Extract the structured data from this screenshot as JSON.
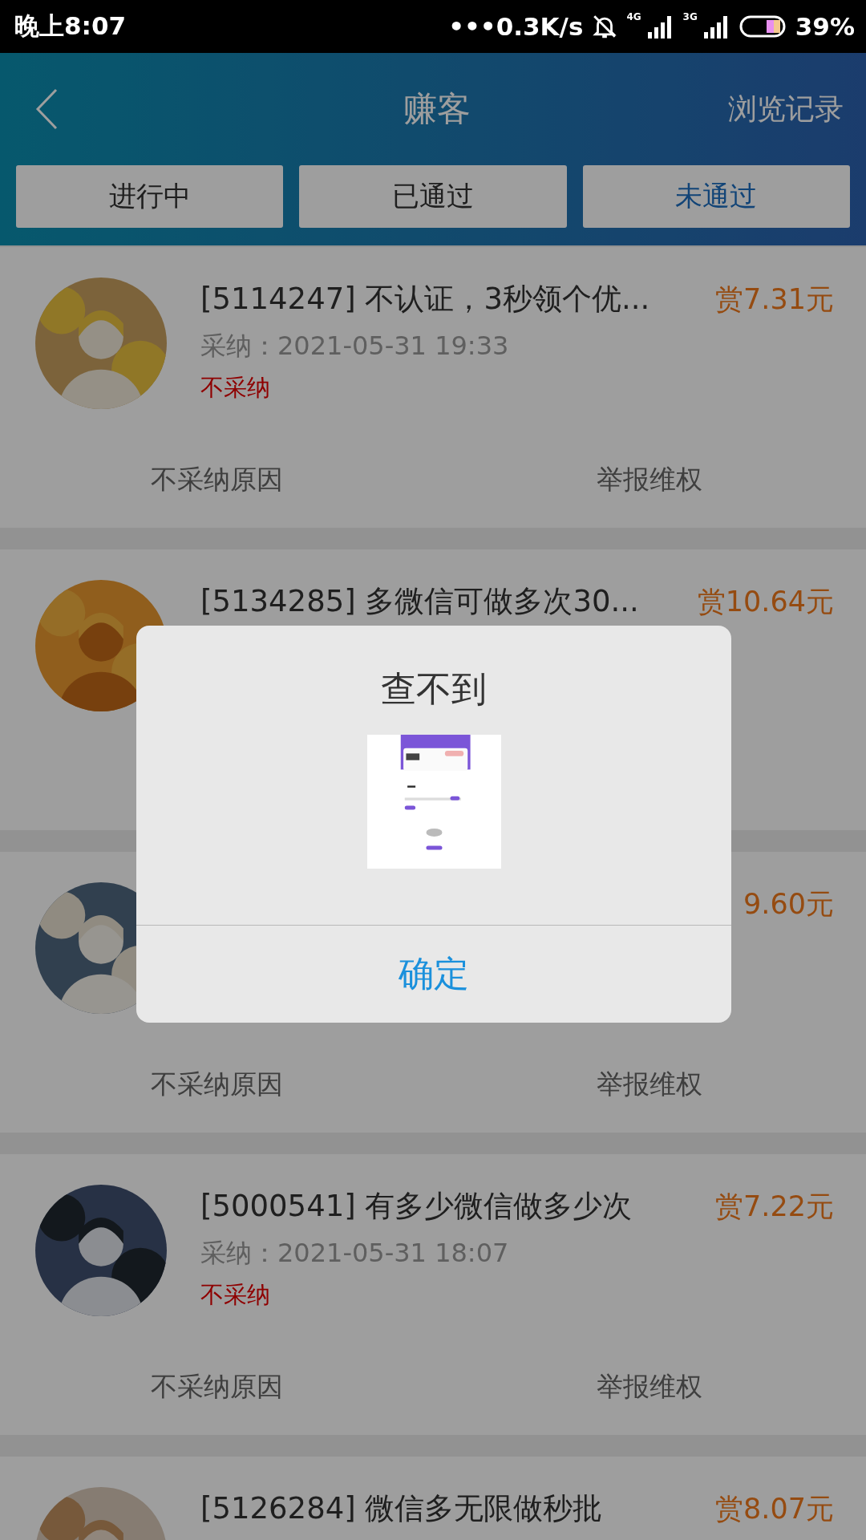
{
  "status_bar": {
    "time": "晚上8:07",
    "network_speed": "•••0.3K/s",
    "signal_1_label": "4G",
    "signal_2_label": "3G",
    "battery": "39%"
  },
  "header": {
    "title": "赚客",
    "right_link": "浏览记录"
  },
  "tabs": [
    {
      "label": "进行中",
      "selected": false
    },
    {
      "label": "已通过",
      "selected": false
    },
    {
      "label": "未通过",
      "selected": true
    }
  ],
  "tasks": [
    {
      "title": "[5114247] 不认证，3秒领个优...",
      "reward": "赏7.31元",
      "date": "采纳：2021-05-31 19:33",
      "status": "不采纳",
      "actions": [
        "不采纳原因",
        "举报维权"
      ]
    },
    {
      "title": "[5134285] 多微信可做多次30...",
      "reward": "赏10.64元"
    },
    {
      "reward": "9.60元",
      "actions": [
        "不采纳原因",
        "举报维权"
      ]
    },
    {
      "title": "[5000541] 有多少微信做多少次",
      "reward": "赏7.22元",
      "date": "采纳：2021-05-31 18:07",
      "status": "不采纳",
      "actions": [
        "不采纳原因",
        "举报维权"
      ]
    },
    {
      "title": "[5126284] 微信多无限做秒批",
      "reward": "赏8.07元"
    }
  ],
  "dialog": {
    "title": "查不到",
    "button": "确定"
  }
}
